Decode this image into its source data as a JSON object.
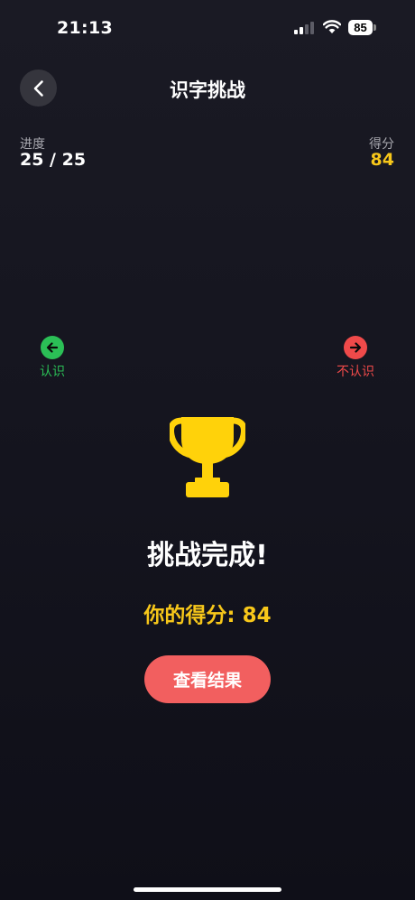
{
  "status_bar": {
    "time": "21:13",
    "battery": "85"
  },
  "header": {
    "title": "识字挑战"
  },
  "stats": {
    "progress_label": "进度",
    "progress_value": "25 / 25",
    "score_label": "得分",
    "score_value": "84"
  },
  "hints": {
    "known_label": "认识",
    "unknown_label": "不认识"
  },
  "result": {
    "title": "挑战完成!",
    "score_text": "你的得分: 84",
    "view_button_label": "查看结果"
  },
  "colors": {
    "accent_gold": "#f7c71a",
    "known_green": "#2bbf56",
    "unknown_red": "#f04a4a",
    "button_coral": "#f25f5f"
  }
}
